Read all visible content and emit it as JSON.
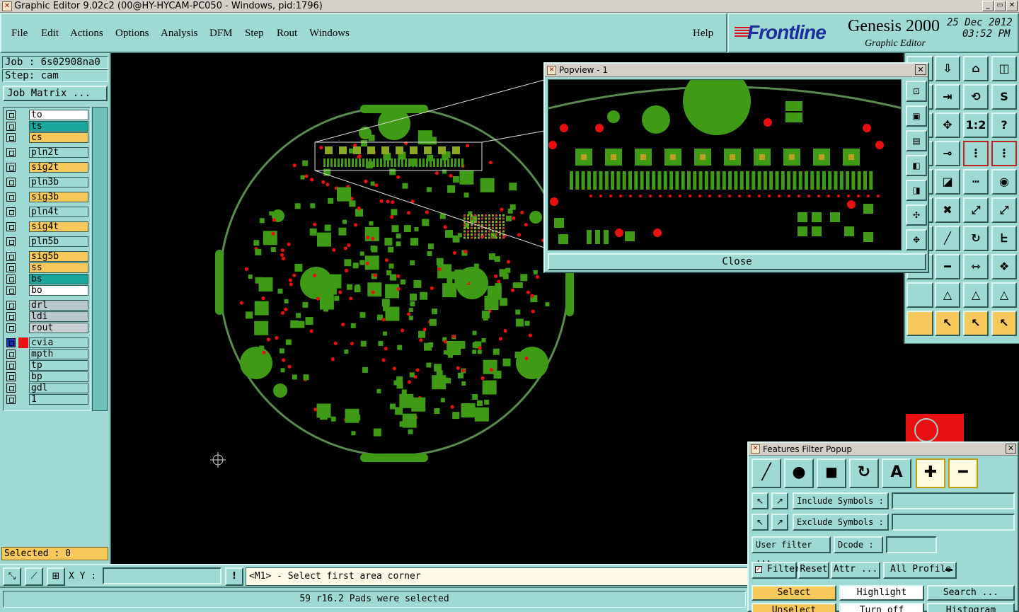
{
  "window": {
    "title": "Graphic Editor 9.02c2 (00@HY-HYCAM-PC050 - Windows, pid:1796)",
    "minimize": "_",
    "restore": "▭",
    "close": "✕"
  },
  "menu": [
    "File",
    "Edit",
    "Actions",
    "Options",
    "Analysis",
    "DFM",
    "Step",
    "Rout",
    "Windows"
  ],
  "help": "Help",
  "brand": {
    "logo": "Frontline",
    "product": "Genesis 2000",
    "subtitle": "Graphic Editor",
    "date": "25 Dec 2012",
    "time": "03:52 PM"
  },
  "left": {
    "job": "Job : 6s02908na0",
    "step": "Step: cam",
    "job_matrix": "Job Matrix ...",
    "selected": "Selected : 0"
  },
  "layers": [
    {
      "name": "to",
      "color": "#ffffff"
    },
    {
      "name": "ts",
      "color": "#1aa69a"
    },
    {
      "name": "cs",
      "color": "#f7c85a"
    },
    {
      "name": "pln2t",
      "color": "#9fd9d3"
    },
    {
      "name": "sig2t",
      "color": "#f7c85a"
    },
    {
      "name": "pln3b",
      "color": "#9fd9d3"
    },
    {
      "name": "sig3b",
      "color": "#f7c85a"
    },
    {
      "name": "pln4t",
      "color": "#9fd9d3"
    },
    {
      "name": "sig4t",
      "color": "#f7c85a"
    },
    {
      "name": "pln5b",
      "color": "#9fd9d3"
    },
    {
      "name": "sig5b",
      "color": "#f7c85a"
    },
    {
      "name": "ss",
      "color": "#f7c85a"
    },
    {
      "name": "bs",
      "color": "#1aa69a"
    },
    {
      "name": "bo",
      "color": "#ffffff"
    },
    {
      "name": "drl",
      "color": "#b8c8cc"
    },
    {
      "name": "ldi",
      "color": "#b8c8cc"
    },
    {
      "name": "rout",
      "color": "#c8d0d4"
    },
    {
      "name": "cvia",
      "color": "#9fd9d3"
    },
    {
      "name": "mpth",
      "color": "#9fd9d3"
    },
    {
      "name": "tp",
      "color": "#9fd9d3"
    },
    {
      "name": "bp",
      "color": "#9fd9d3"
    },
    {
      "name": "gdl",
      "color": "#9fd9d3"
    },
    {
      "name": "1",
      "color": "#9fd9d3"
    }
  ],
  "popview": {
    "title": "Popview - 1",
    "close_label": "Close",
    "close_x": "✕"
  },
  "bottom": {
    "xy_label": "X Y :",
    "xy_value": "",
    "alert": "!",
    "message": "<M1> - Select first area corner",
    "status": "59 r16.2 Pads were selected"
  },
  "filter": {
    "title": "Features Filter Popup",
    "close_x": "✕",
    "include_label": "Include Symbols :",
    "exclude_label": "Exclude Symbols :",
    "user_filter": "User filter ...",
    "dcode": "Dcode :",
    "filter_label": "Filter",
    "reset": "Reset",
    "attr": "Attr ...",
    "all_profile": "All Profile",
    "select": "Select",
    "highlight": "Highlight",
    "search": "Search ...",
    "unselect": "Unselect",
    "turn_off": "Turn off",
    "histogram": "Histogram"
  },
  "colors": {
    "panel": "#9fd9d3",
    "pad": "#3f9a16",
    "drill": "#e81010",
    "highlight": "#f7c85a"
  }
}
